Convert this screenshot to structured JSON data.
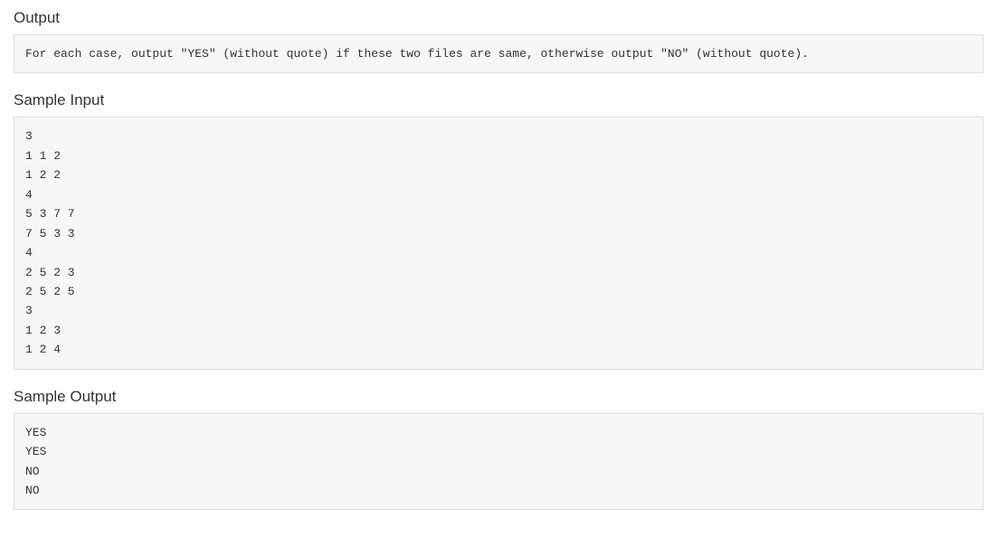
{
  "sections": {
    "output": {
      "title": "Output",
      "content": "For each case, output \"YES\" (without quote) if these two files are same, otherwise output \"NO\" (without quote)."
    },
    "sample_input": {
      "title": "Sample Input",
      "content": "3\n1 1 2\n1 2 2\n4\n5 3 7 7\n7 5 3 3\n4\n2 5 2 3\n2 5 2 5\n3\n1 2 3\n1 2 4"
    },
    "sample_output": {
      "title": "Sample Output",
      "content": "YES\nYES\nNO\nNO"
    }
  }
}
